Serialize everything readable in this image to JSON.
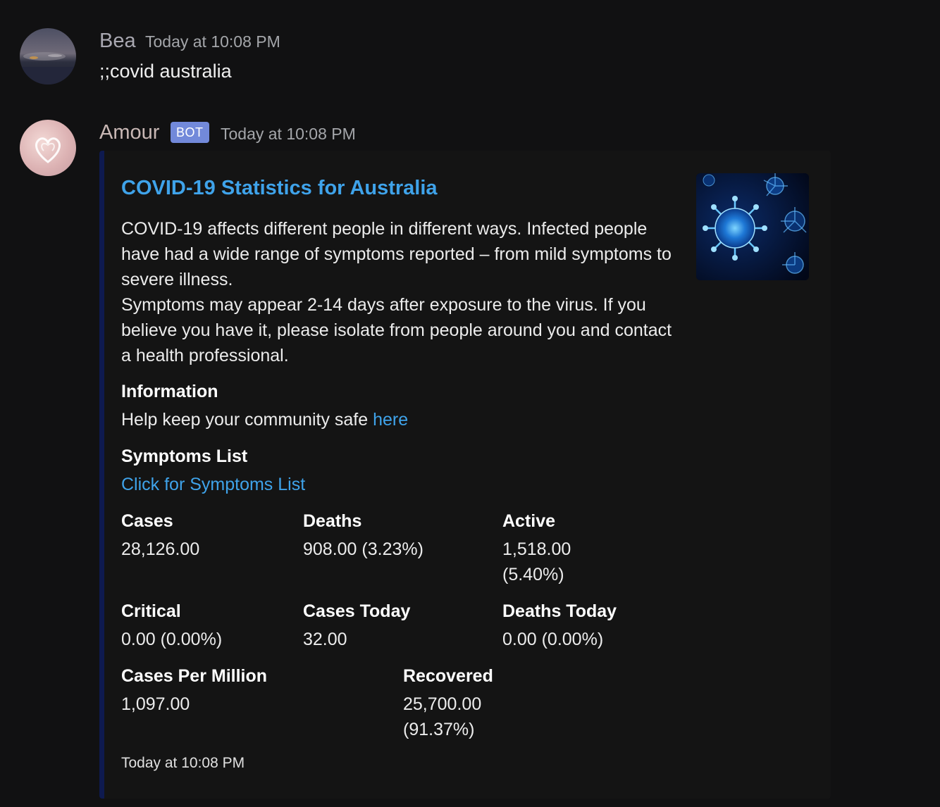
{
  "messages": [
    {
      "author": "Bea",
      "timestamp": "Today at 10:08 PM",
      "content": ";;covid australia",
      "author_color": "#a9a8b1"
    },
    {
      "author": "Amour",
      "badge": "BOT",
      "timestamp": "Today at 10:08 PM",
      "author_color": "#c9b8b5"
    }
  ],
  "embed": {
    "title": "COVID-19 Statistics for Australia",
    "description": [
      "COVID-19 affects different people in different ways. Infected people have had a wide range of symptoms reported – from mild symptoms to severe illness.",
      "Symptoms may appear 2-14 days after exposure to the virus. If you believe you have it, please isolate from people around you and contact a health professional."
    ],
    "information": {
      "name": "Information",
      "text": "Help keep your community safe ",
      "link": "here"
    },
    "symptoms": {
      "name": "Symptoms List",
      "link": "Click for Symptoms List"
    },
    "fields": [
      {
        "name": "Cases",
        "value": "28,126.00"
      },
      {
        "name": "Deaths",
        "value": "908.00 (3.23%)"
      },
      {
        "name": "Active",
        "value": "1,518.00 (5.40%)"
      },
      {
        "name": "Critical",
        "value": "0.00 (0.00%)"
      },
      {
        "name": "Cases Today",
        "value": "32.00"
      },
      {
        "name": "Deaths Today",
        "value": "0.00 (0.00%)"
      },
      {
        "name": "Cases Per Million",
        "value": "1,097.00"
      },
      {
        "name": "Recovered",
        "value": "25,700.00 (91.37%)"
      }
    ],
    "footer": "Today at 10:08 PM",
    "accent_color": "#0e1a4f",
    "link_color": "#3fa3ea",
    "thumbnail_icon": "virus-image"
  }
}
